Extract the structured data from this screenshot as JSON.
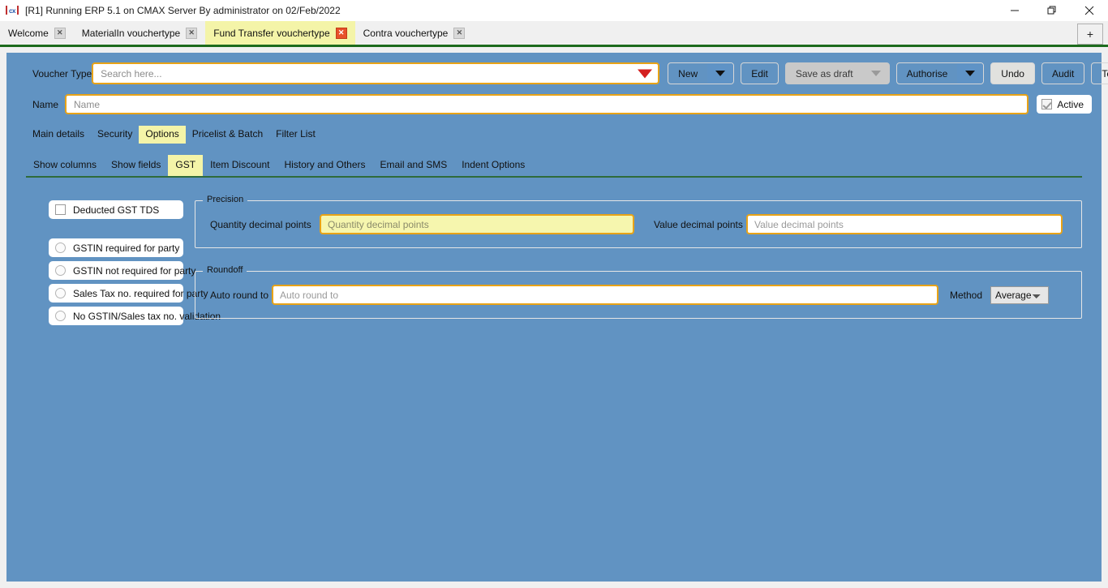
{
  "window": {
    "title": "[R1] Running ERP 5.1 on CMAX Server By administrator on 02/Feb/2022",
    "app_icon": "cx",
    "minimize_label": "–",
    "restore_label": "❐",
    "close_label": "✕"
  },
  "tabstrip": {
    "new_tab_label": "+",
    "tabs": [
      {
        "label": "Welcome",
        "close": "✕",
        "active": false
      },
      {
        "label": "MaterialIn vouchertype",
        "close": "✕",
        "active": false
      },
      {
        "label": "Fund Transfer vouchertype",
        "close": "✕",
        "active": true
      },
      {
        "label": "Contra vouchertype",
        "close": "✕",
        "active": false
      }
    ]
  },
  "form": {
    "voucher_type_label": "Voucher Type",
    "search_placeholder": "Search here...",
    "search_value": "",
    "name_label": "Name",
    "name_placeholder": "Name",
    "name_value": "",
    "active_label": "Active",
    "active_checked": true
  },
  "toolbar": {
    "new_label": "New",
    "edit_label": "Edit",
    "save_as_draft_label": "Save as draft",
    "authorise_label": "Authorise",
    "undo_label": "Undo",
    "audit_label": "Audit",
    "template_label": "Template"
  },
  "main_tabs": [
    {
      "label": "Main details",
      "active": false
    },
    {
      "label": "Security",
      "active": false
    },
    {
      "label": "Options",
      "active": true
    },
    {
      "label": "Pricelist & Batch",
      "active": false
    },
    {
      "label": "Filter List",
      "active": false
    }
  ],
  "sub_tabs": [
    {
      "label": "Show columns",
      "active": false
    },
    {
      "label": "Show fields",
      "active": false
    },
    {
      "label": "GST",
      "active": true
    },
    {
      "label": "Item Discount",
      "active": false
    },
    {
      "label": "History and Others",
      "active": false
    },
    {
      "label": "Email and SMS",
      "active": false
    },
    {
      "label": "Indent Options",
      "active": false
    }
  ],
  "options": {
    "checkbox": {
      "label": "Deducted GST TDS",
      "checked": false
    },
    "radios": [
      {
        "label": "GSTIN required for party",
        "selected": false
      },
      {
        "label": "GSTIN not required for party",
        "selected": false
      },
      {
        "label": "Sales Tax no. required for party",
        "selected": false
      },
      {
        "label": "No GSTIN/Sales tax no. validation",
        "selected": false
      }
    ]
  },
  "precision": {
    "title": "Precision",
    "quantity_label": "Quantity decimal points",
    "quantity_placeholder": "Quantity decimal points",
    "quantity_value": "",
    "value_label": "Value decimal points",
    "value_placeholder": "Value decimal points",
    "value_value": ""
  },
  "roundoff": {
    "title": "Roundoff",
    "auto_round_label": "Auto round to",
    "auto_round_placeholder": "Auto round to",
    "auto_round_value": "",
    "method_label": "Method",
    "method_value": "Average",
    "method_options": [
      "Average"
    ]
  },
  "colors": {
    "content_bg": "#6193c2",
    "accent_yellow": "#f4f4a8",
    "focus_border": "#e8a317",
    "focus_fill": "#f6f6ae",
    "tab_underline": "#1d6b1d",
    "subtab_underline": "#2f6b3a",
    "close_active": "#e8502a",
    "dropdown_red": "#d42020"
  }
}
